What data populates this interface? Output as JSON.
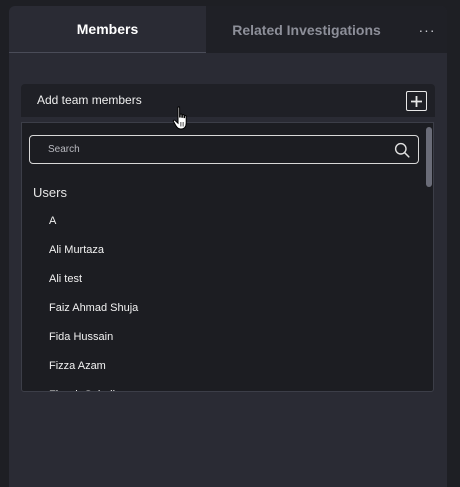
{
  "tabs": {
    "members": "Members",
    "related": "Related Investigations",
    "more": "···"
  },
  "add_members": {
    "label": "Add team members"
  },
  "search": {
    "placeholder": "Search",
    "value": ""
  },
  "users": {
    "group_label": "Users",
    "items": [
      "A",
      "Ali Murtaza",
      "Ali test",
      "Faiz Ahmad Shuja",
      "Fida Hussain",
      "Fizza Azam",
      "Fizzah Sohail"
    ]
  },
  "colors": {
    "background": "#1e1f24",
    "panel": "#2a2b34",
    "dropdown": "#1c1d22",
    "text": "#f2f2f2",
    "muted_text": "#8d8f99"
  }
}
